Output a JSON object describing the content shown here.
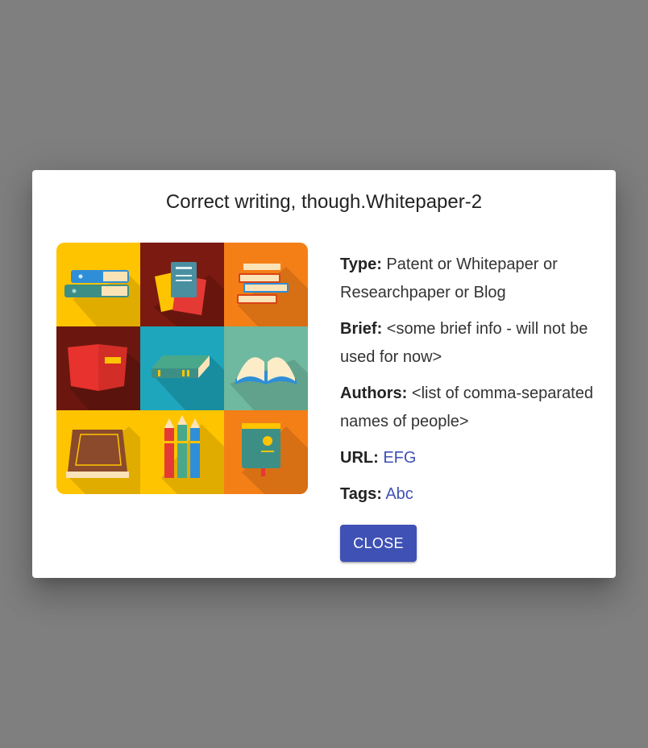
{
  "dialog": {
    "title": "Correct writing, though.Whitepaper-2",
    "cover_image": "books-collection-illustration",
    "fields": {
      "type_label": "Type:",
      "type_value": "Patent or Whitepaper or Researchpaper or Blog",
      "brief_label": "Brief:",
      "brief_value": "<some brief info - will not be used for now>",
      "authors_label": "Authors:",
      "authors_value": "<list of comma-separated names of people>",
      "url_label": "URL:",
      "url_value": "EFG",
      "tags_label": "Tags:",
      "tags_value": "Abc"
    },
    "close_label": "CLOSE"
  },
  "colors": {
    "overlay": "#7f7f7f",
    "primary": "#3f51b5",
    "surface": "#ffffff"
  }
}
